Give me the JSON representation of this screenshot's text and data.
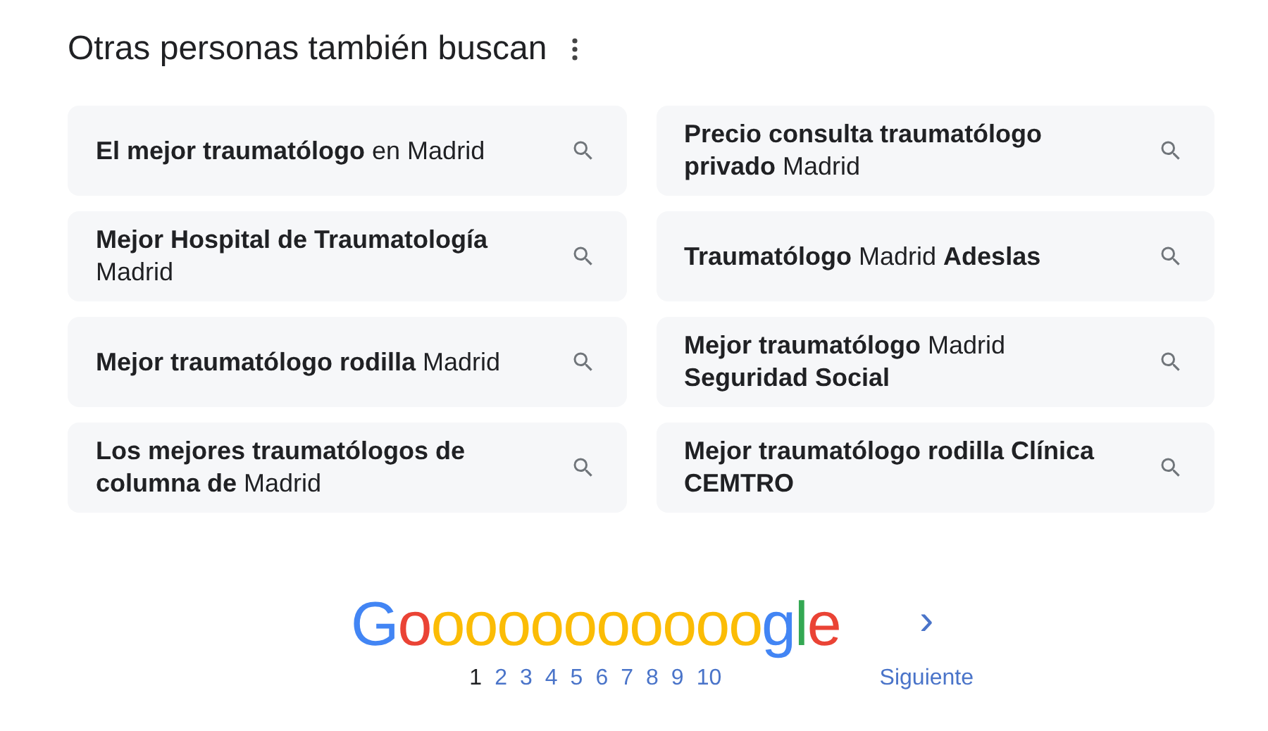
{
  "heading": "Otras personas también buscan",
  "search_rows": [
    {
      "items": [
        {
          "text": "**El mejor traumatólogo** en Madrid"
        },
        {
          "text": "**Precio consulta traumatólogo privado** Madrid"
        }
      ]
    },
    {
      "items": [
        {
          "text": "**Mejor Hospital de Traumatología** Madrid"
        },
        {
          "text": "**Traumatólogo** Madrid **Adeslas**"
        }
      ]
    },
    {
      "items": [
        {
          "text": "**Mejor traumatólogo rodilla** Madrid"
        },
        {
          "text": "**Mejor traumatólogo** Madrid **Seguridad Social**"
        }
      ]
    },
    {
      "items": [
        {
          "text": "**Los mejores traumatólogos de columna de** Madrid"
        },
        {
          "text": "**Mejor traumatólogo rodilla Clínica CEMTRO**"
        }
      ]
    }
  ],
  "logo": [
    {
      "letter": "G",
      "color": "#4285f4"
    },
    {
      "letter": "o",
      "color": "#ea4335"
    },
    {
      "letter": "o",
      "color": "#fbbc05"
    },
    {
      "letter": "o",
      "color": "#fbbc05"
    },
    {
      "letter": "o",
      "color": "#fbbc05"
    },
    {
      "letter": "o",
      "color": "#fbbc05"
    },
    {
      "letter": "o",
      "color": "#fbbc05"
    },
    {
      "letter": "o",
      "color": "#fbbc05"
    },
    {
      "letter": "o",
      "color": "#fbbc05"
    },
    {
      "letter": "o",
      "color": "#fbbc05"
    },
    {
      "letter": "o",
      "color": "#fbbc05"
    },
    {
      "letter": "o",
      "color": "#fbbc05"
    },
    {
      "letter": "g",
      "color": "#4285f4"
    },
    {
      "letter": "l",
      "color": "#34a853"
    },
    {
      "letter": "e",
      "color": "#ea4335"
    }
  ],
  "pages": [
    {
      "label": "1",
      "selected": true
    },
    {
      "label": "2",
      "selected": false
    },
    {
      "label": "3",
      "selected": false
    },
    {
      "label": "4",
      "selected": false
    },
    {
      "label": "5",
      "selected": false
    },
    {
      "label": "6",
      "selected": false
    },
    {
      "label": "7",
      "selected": false
    },
    {
      "label": "8",
      "selected": false
    },
    {
      "label": "9",
      "selected": false
    },
    {
      "label": "10",
      "selected": false
    }
  ],
  "next": {
    "chevron": "›",
    "label": "Siguiente"
  }
}
